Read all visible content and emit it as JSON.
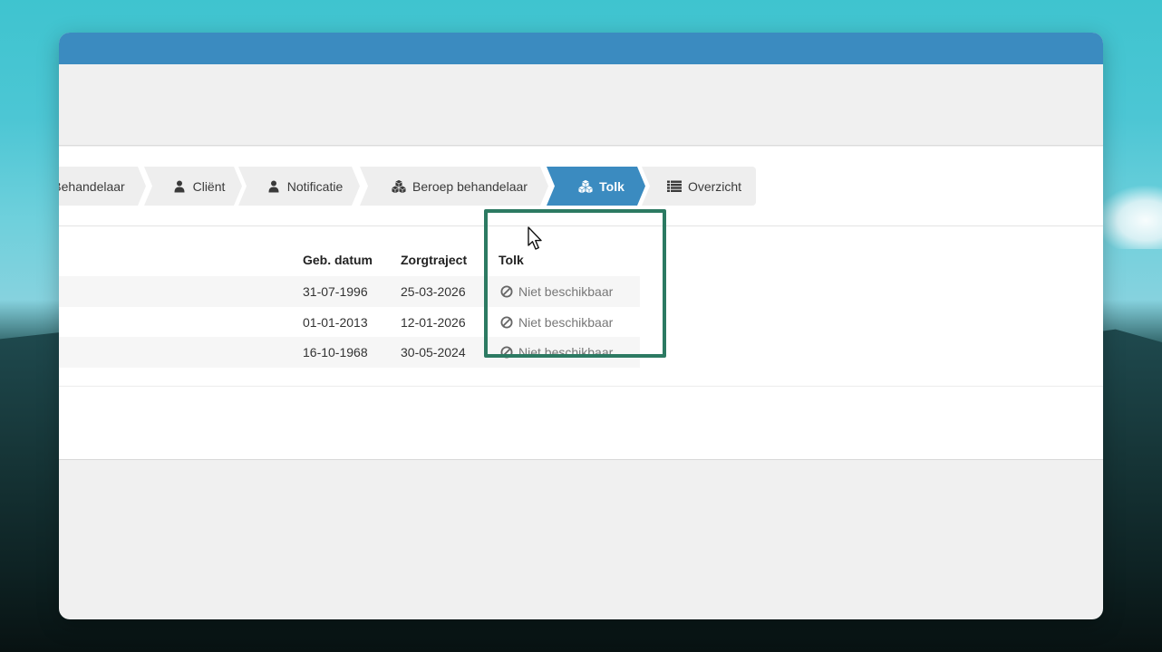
{
  "steps": [
    {
      "label": "Behandelaar",
      "icon": "user-md-icon",
      "active": false
    },
    {
      "label": "Cliënt",
      "icon": "user-icon",
      "active": false
    },
    {
      "label": "Notificatie",
      "icon": "user-icon",
      "active": false
    },
    {
      "label": "Beroep behandelaar",
      "icon": "cubes-icon",
      "active": false
    },
    {
      "label": "Tolk",
      "icon": "cubes-icon",
      "active": true
    },
    {
      "label": "Overzicht",
      "icon": "list-icon",
      "active": false
    }
  ],
  "table": {
    "headers": {
      "geb_datum": "Geb. datum",
      "zorgtraject": "Zorgtraject",
      "tolk": "Tolk"
    },
    "rows": [
      {
        "geb_datum": "31-07-1996",
        "zorgtraject": "25-03-2026",
        "tolk": "Niet beschikbaar"
      },
      {
        "geb_datum": "01-01-2013",
        "zorgtraject": "12-01-2026",
        "tolk": "Niet beschikbaar"
      },
      {
        "geb_datum": "16-10-1968",
        "zorgtraject": "30-05-2024",
        "tolk": "Niet beschikbaar"
      }
    ]
  },
  "colors": {
    "accent": "#3b8bc0",
    "highlight": "#2c7a62"
  }
}
